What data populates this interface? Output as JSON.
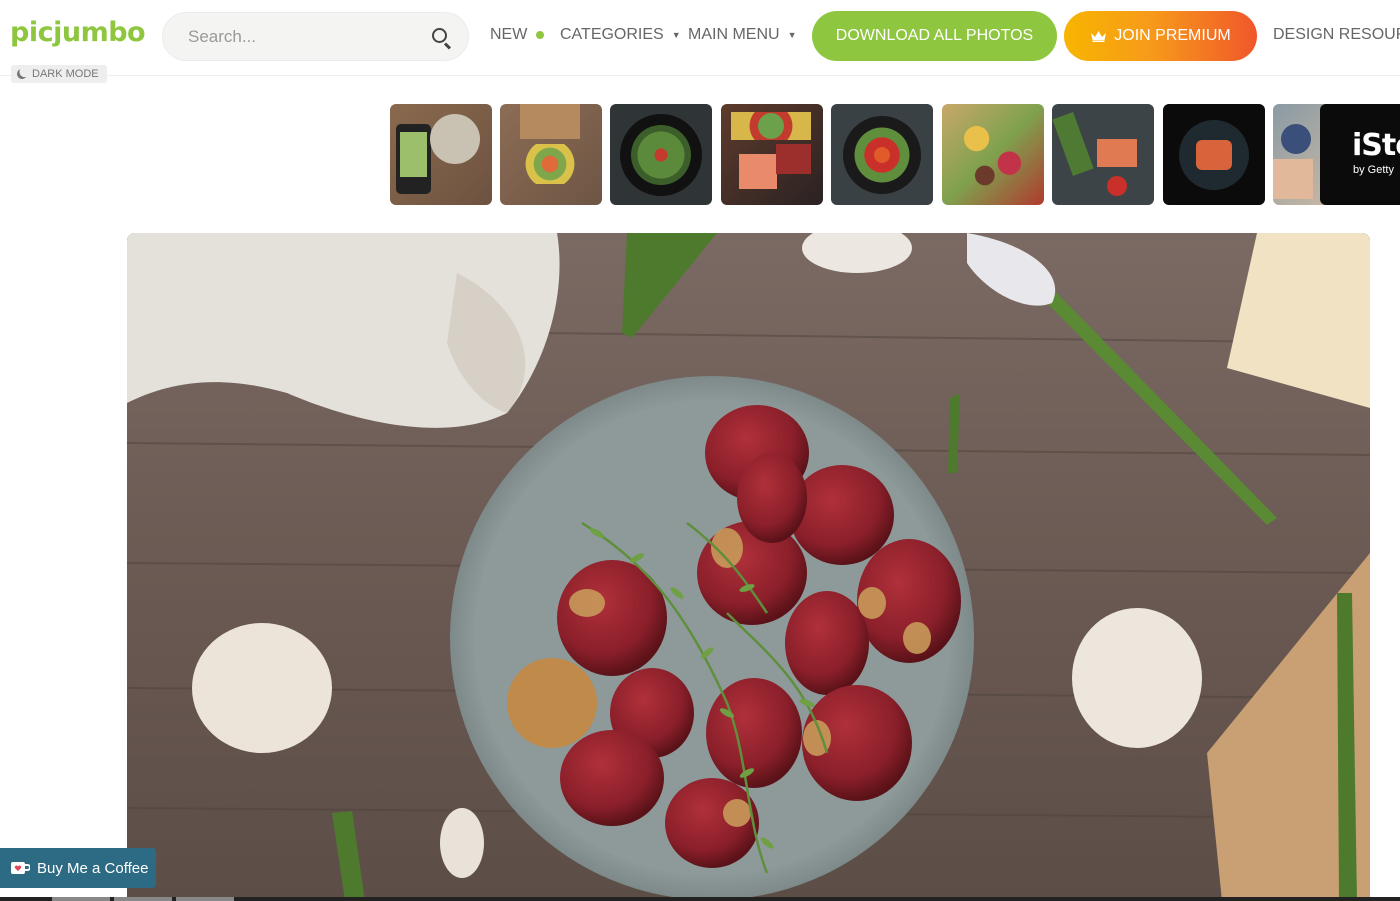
{
  "header": {
    "logo": "picjumbo",
    "dark_mode_label": "DARK MODE",
    "search": {
      "placeholder": "Search...",
      "value": ""
    },
    "nav": {
      "new_label": "NEW",
      "categories_label": "CATEGORIES",
      "main_menu_label": "MAIN MENU",
      "design_resources_label": "DESIGN RESOURC"
    },
    "download_all_label": "DOWNLOAD ALL PHOTOS",
    "join_premium_label": "JOIN PREMIUM"
  },
  "related_thumbnails": [
    {
      "subject": "phone photographing salad on wooden table"
    },
    {
      "subject": "vegetables from paper bag"
    },
    {
      "subject": "salad bowl on dark background"
    },
    {
      "subject": "meat fish and vegetables flat lay"
    },
    {
      "subject": "salad bowl on dark slate"
    },
    {
      "subject": "healthy food spread"
    },
    {
      "subject": "salmon and asparagus"
    },
    {
      "subject": "salmon dish on black plate"
    },
    {
      "subject": "breakfast table"
    }
  ],
  "istock_ad": {
    "logo": "iSto",
    "sub": "by Getty"
  },
  "main_photo": {
    "subject": "red potatoes with thyme in grey bowl on rustic wooden table"
  },
  "coffee_button_label": "Buy Me a Coffee",
  "colors": {
    "brand_green": "#8ec63f",
    "premium_orange": "#f79a1a",
    "premium_red": "#f0572b",
    "coffee_blue": "#2d6b84"
  },
  "icons": [
    "moon-icon",
    "search-icon",
    "crown-icon",
    "cup-icon",
    "caret-down-icon"
  ]
}
